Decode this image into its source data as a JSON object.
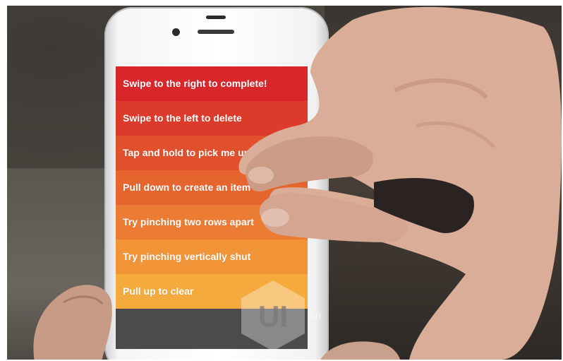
{
  "todo_list": {
    "items": [
      {
        "label": "Swipe to the right to complete!",
        "color": "#d8262a"
      },
      {
        "label": "Swipe to the left to delete",
        "color": "#dc3a2b"
      },
      {
        "label": "Tap and hold to pick me up",
        "color": "#e0502c"
      },
      {
        "label": "Pull down to create an item",
        "color": "#e6652f"
      },
      {
        "label": "Try pinching two rows apart",
        "color": "#ec7b33"
      },
      {
        "label": "Try pinching vertically shut",
        "color": "#f19438"
      },
      {
        "label": "Pull up to clear",
        "color": "#f5aa3d"
      }
    ]
  },
  "watermark": {
    "logo_text": "UI",
    "suffix": "cn"
  }
}
